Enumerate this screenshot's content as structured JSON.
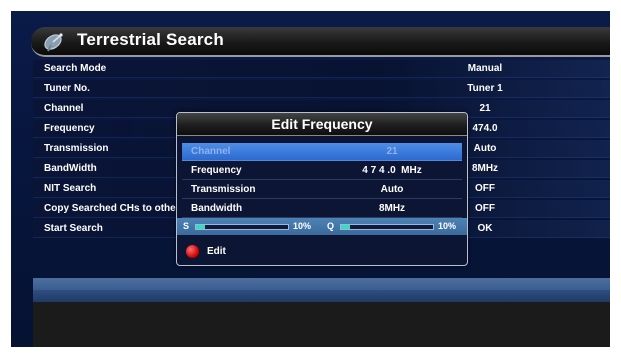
{
  "screen_title": "Terrestrial Search",
  "title_icon": "satellite-dish-icon",
  "settings_rows": [
    {
      "label": "Search Mode",
      "value": "Manual"
    },
    {
      "label": "Tuner No.",
      "value": "Tuner 1"
    },
    {
      "label": "Channel",
      "value": "21"
    },
    {
      "label": "Frequency",
      "value": "474.0"
    },
    {
      "label": "Transmission",
      "value": "Auto"
    },
    {
      "label": "BandWidth",
      "value": "8MHz"
    },
    {
      "label": "NIT Search",
      "value": "OFF"
    },
    {
      "label": "Copy Searched CHs to other",
      "value": "OFF"
    },
    {
      "label": "Start Search",
      "value": "OK"
    }
  ],
  "dialog": {
    "title": "Edit Frequency",
    "rows": [
      {
        "label": "Channel",
        "value": "21",
        "selected": true
      },
      {
        "label": "Frequency",
        "value": "4 7 4 .0  MHz",
        "selected": false
      },
      {
        "label": "Transmission",
        "value": "Auto",
        "selected": false
      },
      {
        "label": "Bandwidth",
        "value": "8MHz",
        "selected": false
      }
    ],
    "signal": {
      "strength_label": "S",
      "strength_percent": "10%",
      "strength_level": 0.1,
      "quality_label": "Q",
      "quality_percent": "10%",
      "quality_level": 0.1
    },
    "footer": {
      "button_color": "red",
      "label": "Edit"
    }
  },
  "colors": {
    "background": "#07163e",
    "selection": "#2c6ad0",
    "signal_fill": "#30e0c0",
    "edit_button": "#d00000"
  }
}
